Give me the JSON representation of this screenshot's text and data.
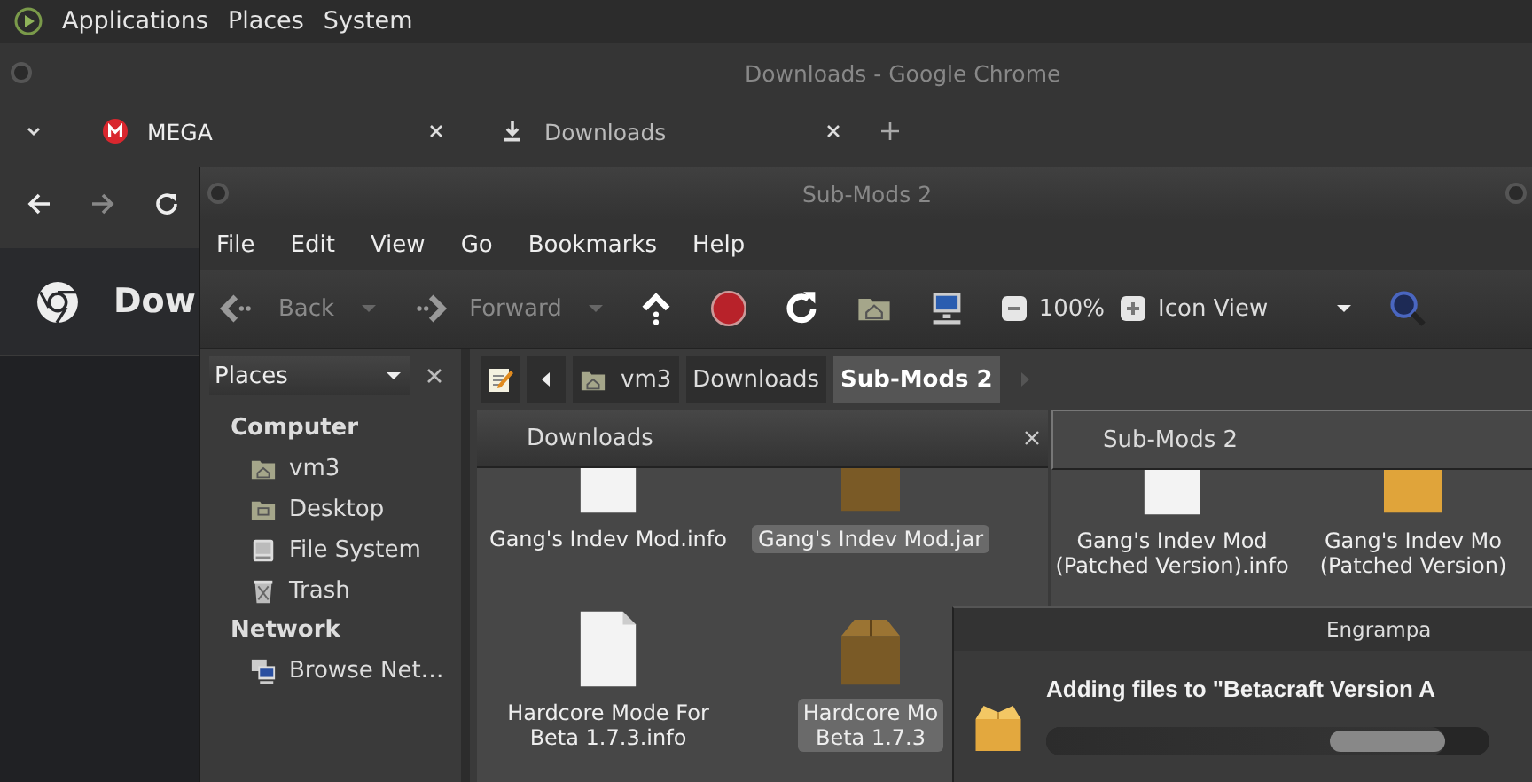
{
  "panel": {
    "menus": [
      "Applications",
      "Places",
      "System"
    ]
  },
  "chrome": {
    "title": "Downloads - Google Chrome",
    "tabs": [
      {
        "label": "MEGA",
        "selected": false
      },
      {
        "label": "Downloads",
        "selected": true
      }
    ],
    "page_title": "Dow"
  },
  "filemanager": {
    "title": "Sub-Mods 2",
    "menu": [
      "File",
      "Edit",
      "View",
      "Go",
      "Bookmarks",
      "Help"
    ],
    "toolbar": {
      "back": "Back",
      "forward": "Forward",
      "zoom": "100%",
      "view": "Icon View"
    },
    "sidebar": {
      "selector": "Places",
      "sections": [
        {
          "heading": "Computer",
          "items": [
            {
              "label": "vm3"
            },
            {
              "label": "Desktop"
            },
            {
              "label": "File System"
            },
            {
              "label": "Trash"
            }
          ]
        },
        {
          "heading": "Network",
          "items": [
            {
              "label": "Browse Net…"
            }
          ]
        }
      ]
    },
    "pathbar": [
      {
        "label": "vm3",
        "selected": false
      },
      {
        "label": "Downloads",
        "selected": false
      },
      {
        "label": "Sub-Mods 2",
        "selected": true
      }
    ],
    "panes": [
      {
        "tab": "Downloads",
        "selected": false,
        "files": [
          {
            "lines": [
              "Gang's Indev Mod.info"
            ],
            "kind": "document",
            "selected": false
          },
          {
            "lines": [
              "Gang's Indev Mod.jar"
            ],
            "kind": "archive",
            "selected": true
          },
          {
            "lines": [
              "Hardcore Mode For",
              "Beta 1.7.3.info"
            ],
            "kind": "document",
            "selected": false
          },
          {
            "lines": [
              "Hardcore Mo",
              "Beta 1.7.3"
            ],
            "kind": "archive",
            "selected": true
          }
        ]
      },
      {
        "tab": "Sub-Mods 2",
        "selected": true,
        "files": [
          {
            "lines": [
              "Gang's Indev Mod",
              "(Patched Version).info"
            ],
            "kind": "document",
            "selected": false
          },
          {
            "lines": [
              "Gang's Indev Mo",
              "(Patched Version)"
            ],
            "kind": "zip",
            "selected": false
          }
        ]
      }
    ]
  },
  "dialog": {
    "title": "Engrampa",
    "message": "Adding files to \"Betacraft Version A",
    "progress": {
      "level": 0.9
    }
  }
}
